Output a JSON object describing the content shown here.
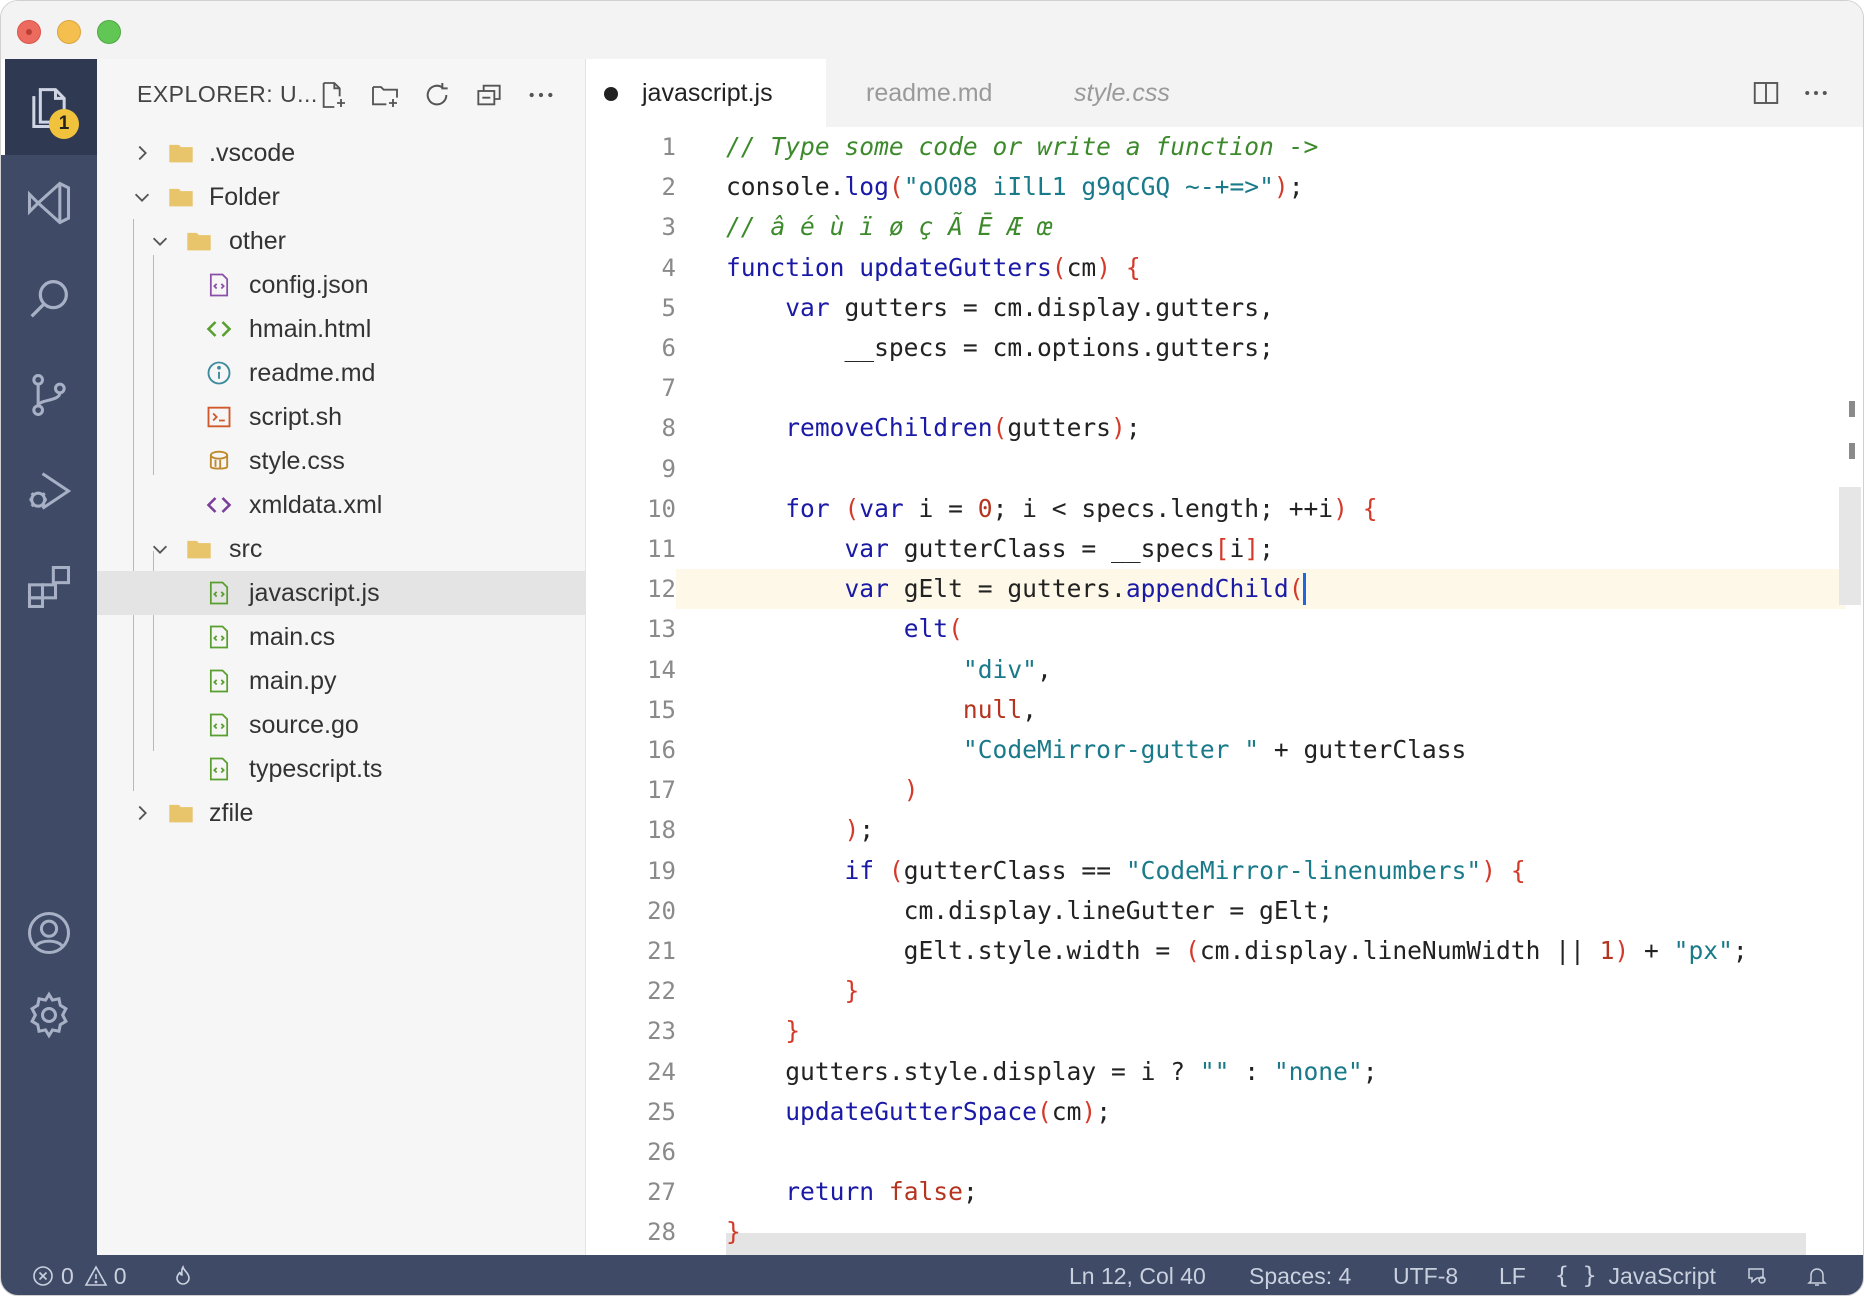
{
  "window": {
    "traffic_lights": [
      "close",
      "minimize",
      "maximize"
    ]
  },
  "activity_bar": {
    "items": [
      {
        "name": "explorer",
        "icon": "files-icon",
        "badge": "1",
        "active": true
      },
      {
        "name": "visual-studio",
        "icon": "visual-studio-icon"
      },
      {
        "name": "search",
        "icon": "search-icon"
      },
      {
        "name": "source-control",
        "icon": "source-control-icon"
      },
      {
        "name": "run-debug",
        "icon": "run-debug-icon"
      },
      {
        "name": "extensions",
        "icon": "extensions-icon"
      }
    ],
    "bottom_items": [
      {
        "name": "accounts",
        "icon": "account-icon"
      },
      {
        "name": "settings",
        "icon": "gear-icon"
      }
    ]
  },
  "sidebar": {
    "title": "EXPLORER: U...",
    "actions": [
      "new-file-icon",
      "new-folder-icon",
      "refresh-icon",
      "collapse-all-icon",
      "more-icon"
    ],
    "tree": [
      {
        "label": ".vscode",
        "kind": "folder",
        "depth": 0,
        "expanded": false
      },
      {
        "label": "Folder",
        "kind": "folder",
        "depth": 0,
        "expanded": true
      },
      {
        "label": "other",
        "kind": "folder",
        "depth": 1,
        "expanded": true
      },
      {
        "label": "config.json",
        "kind": "json",
        "depth": 2
      },
      {
        "label": "hmain.html",
        "kind": "html",
        "depth": 2
      },
      {
        "label": "readme.md",
        "kind": "info",
        "depth": 2
      },
      {
        "label": "script.sh",
        "kind": "shell",
        "depth": 2
      },
      {
        "label": "style.css",
        "kind": "css",
        "depth": 2
      },
      {
        "label": "xmldata.xml",
        "kind": "xml",
        "depth": 2
      },
      {
        "label": "src",
        "kind": "folder",
        "depth": 1,
        "expanded": true
      },
      {
        "label": "javascript.js",
        "kind": "code",
        "depth": 2,
        "selected": true
      },
      {
        "label": "main.cs",
        "kind": "code",
        "depth": 2
      },
      {
        "label": "main.py",
        "kind": "code",
        "depth": 2
      },
      {
        "label": "source.go",
        "kind": "code",
        "depth": 2
      },
      {
        "label": "typescript.ts",
        "kind": "code",
        "depth": 2
      },
      {
        "label": "zfile",
        "kind": "folder",
        "depth": 0,
        "expanded": false
      }
    ]
  },
  "editor": {
    "tabs": [
      {
        "label": "javascript.js",
        "active": true,
        "modified": true
      },
      {
        "label": "readme.md",
        "active": false
      },
      {
        "label": "style.css",
        "active": false,
        "preview": true
      }
    ],
    "actions": [
      "split-editor-icon",
      "more-icon"
    ],
    "current_line": 12,
    "lines": [
      "// Type some code or write a function ->",
      "console.log(\"oO08 iIlL1 g9qCGQ ~-+=>\");",
      "// â é ù ï ø ç Ã Ē Æ œ",
      "function updateGutters(cm) {",
      "    var gutters = cm.display.gutters,",
      "        __specs = cm.options.gutters;",
      "",
      "    removeChildren(gutters);",
      "",
      "    for (var i = 0; i < specs.length; ++i) {",
      "        var gutterClass = __specs[i];",
      "        var gElt = gutters.appendChild(",
      "            elt(",
      "                \"div\",",
      "                null,",
      "                \"CodeMirror-gutter \" + gutterClass",
      "            )",
      "        );",
      "        if (gutterClass == \"CodeMirror-linenumbers\") {",
      "            cm.display.lineGutter = gElt;",
      "            gElt.style.width = (cm.display.lineNumWidth || 1) + \"px\";",
      "        }",
      "    }",
      "    gutters.style.display = i ? \"\" : \"none\";",
      "    updateGutterSpace(cm);",
      "",
      "    return false;",
      "}"
    ]
  },
  "status_bar": {
    "errors": "0",
    "warnings": "0",
    "cursor_position": "Ln 12, Col 40",
    "indentation": "Spaces: 4",
    "encoding": "UTF-8",
    "eol": "LF",
    "language": "JavaScript"
  },
  "colors": {
    "activity_bar": "#3e4a66",
    "status_bar": "#3e4a66",
    "keyword": "#1a1aa6",
    "function": "#1a1aa6",
    "string": "#1a7a8a",
    "comment": "#3d8a2c",
    "bracket": "#d43a2a",
    "number_literal": "#b5341f"
  }
}
